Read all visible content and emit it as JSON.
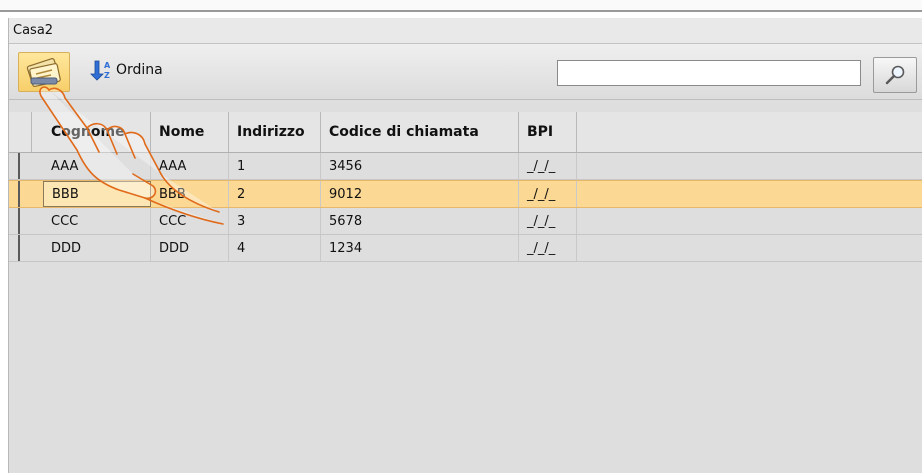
{
  "window": {
    "title": "Casa2"
  },
  "toolbar": {
    "sort_label": "Ordina",
    "search_value": ""
  },
  "colors": {
    "selected_row": "#fbd893",
    "accent": "#f7cf6a"
  },
  "table": {
    "headers": [
      "Cognome",
      "Nome",
      "Indirizzo",
      "Codice di chiamata",
      "BPI"
    ],
    "rows": [
      {
        "cognome": "AAA",
        "nome": "AAA",
        "indirizzo": "1",
        "codice": "3456",
        "bpi": "_/_/_"
      },
      {
        "cognome": "BBB",
        "nome": "BBB",
        "indirizzo": "2",
        "codice": "9012",
        "bpi": "_/_/_"
      },
      {
        "cognome": "CCC",
        "nome": "CCC",
        "indirizzo": "3",
        "codice": "5678",
        "bpi": "_/_/_"
      },
      {
        "cognome": "DDD",
        "nome": "DDD",
        "indirizzo": "4",
        "codice": "1234",
        "bpi": "_/_/_"
      }
    ],
    "selected_row": "BBB"
  }
}
